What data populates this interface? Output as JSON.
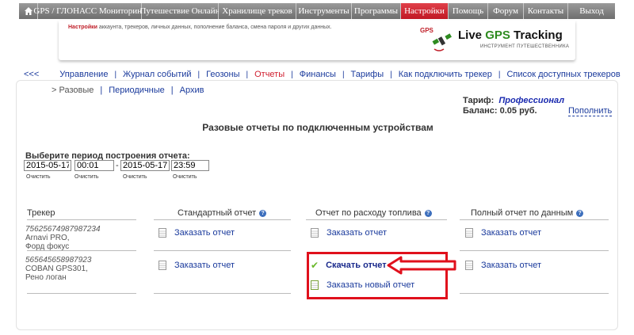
{
  "topnav": {
    "items": [
      {
        "label": "GPS / ГЛОНАСС Мониторинг"
      },
      {
        "label": "Путешествие Онлайн"
      },
      {
        "label": "Хранилище треков"
      },
      {
        "label": "Инструменты"
      },
      {
        "label": "Программы"
      },
      {
        "label": "Настройки",
        "active": true
      },
      {
        "label": "Помощь"
      },
      {
        "label": "Форум"
      },
      {
        "label": "Контакты"
      },
      {
        "label": "Выход"
      }
    ]
  },
  "header": {
    "note_bold": "Настройки",
    "note_rest": " аккаунта, трекеров, личных данных, пополнение баланса, смена пароля и других данных.",
    "gps_tag": "GPS",
    "logo_a": "Live ",
    "logo_b": "GPS",
    "logo_c": " Tracking",
    "logo_sub": "ИНСТРУМЕНТ ПУТЕШЕСТВЕННИКА"
  },
  "secnav": {
    "back": "<<<",
    "items": [
      {
        "label": "Управление"
      },
      {
        "label": "Журнал событий"
      },
      {
        "label": "Геозоны"
      },
      {
        "label": "Отчеты",
        "active": true
      },
      {
        "label": "Финансы"
      },
      {
        "label": "Тарифы"
      },
      {
        "label": "Как подключить трекер"
      },
      {
        "label": "Список доступных трекеров"
      }
    ]
  },
  "subnav": {
    "current": "> Разовые",
    "periodic": "Периодичные",
    "archive": "Архив",
    "sep": "|"
  },
  "account": {
    "tariff_label": "Тариф:",
    "tariff_value": "Профессионал",
    "balance_label": "Баланс: 0.05 руб.",
    "topup": "Пополнить"
  },
  "page_title": "Разовые отчеты по подключенным устройствам",
  "period": {
    "label": "Выберите период построения отчета:",
    "from_date": "2015-05-17",
    "from_time": "00:01",
    "dash": "-",
    "to_date": "2015-05-17",
    "to_time": "23:59",
    "clear": "Очистить"
  },
  "table": {
    "headers": {
      "tracker": "Трекер",
      "standard": "Стандартный отчет",
      "fuel": "Отчет по расходу топлива",
      "full": "Полный отчет по данным"
    },
    "order": "Заказать отчет",
    "download": "Скачать отчет",
    "order_new": "Заказать новый отчет",
    "rows": [
      {
        "id": "75625674987987234",
        "model": "Arnavi PRO,",
        "name": "Форд фокус"
      },
      {
        "id": "565645658987923",
        "model": "COBAN GPS301,",
        "name": "Рено логан"
      }
    ]
  },
  "colors": {
    "accent_red": "#c0202a",
    "link_blue": "#1a3a9c",
    "highlight": "#e0101c",
    "check_green": "#6ab82b"
  }
}
